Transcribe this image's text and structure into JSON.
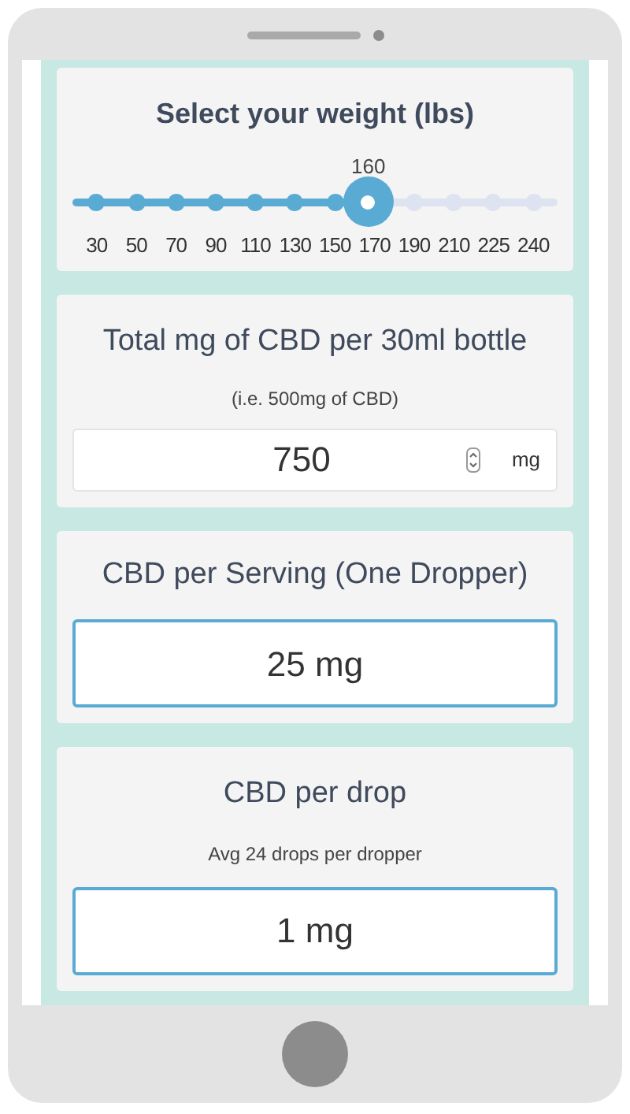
{
  "weight": {
    "title": "Select your weight (lbs)",
    "value_label": "160",
    "level": 0.61,
    "ticks": [
      "30",
      "50",
      "70",
      "90",
      "110",
      "130",
      "150",
      "170",
      "190",
      "210",
      "225",
      "240"
    ]
  },
  "bottle": {
    "title": "Total mg of CBD per 30ml bottle",
    "hint": "(i.e. 500mg of CBD)",
    "value": "750",
    "unit": "mg"
  },
  "serving": {
    "title": "CBD per Serving (One Dropper)",
    "value": "25 mg"
  },
  "drop": {
    "title": "CBD per drop",
    "hint": "Avg 24 drops per dropper",
    "value": "1 mg"
  }
}
